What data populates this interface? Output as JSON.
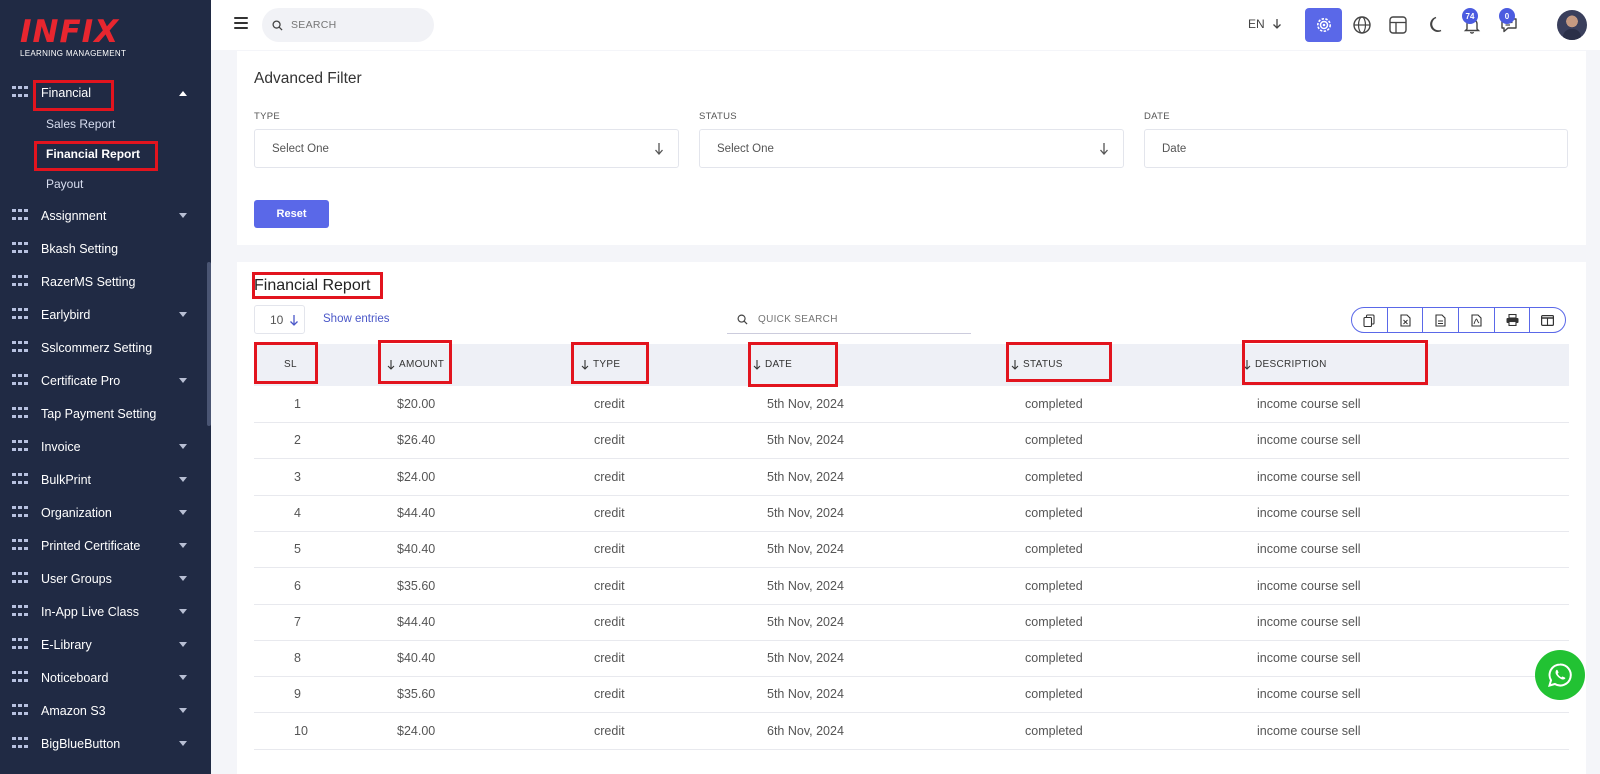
{
  "logo": {
    "main": "INFIX",
    "sub": "LEARNING MANAGEMENT"
  },
  "sidebar": {
    "financial": {
      "label": "Financial",
      "children": [
        "Sales Report",
        "Financial Report",
        "Payout"
      ]
    },
    "items": [
      "Assignment",
      "Bkash Setting",
      "RazerMS Setting",
      "Earlybird",
      "Sslcommerz Setting",
      "Certificate Pro",
      "Tap Payment Setting",
      "Invoice",
      "BulkPrint",
      "Organization",
      "Printed Certificate",
      "User Groups",
      "In-App Live Class",
      "E-Library",
      "Noticeboard",
      "Amazon S3",
      "BigBlueButton"
    ]
  },
  "topbar": {
    "search_placeholder": "SEARCH",
    "language": "EN",
    "notifications_count": "74",
    "messages_count": "0"
  },
  "filter": {
    "title": "Advanced Filter",
    "type_label": "TYPE",
    "type_value": "Select One",
    "status_label": "STATUS",
    "status_value": "Select One",
    "date_label": "DATE",
    "date_placeholder": "Date",
    "reset_label": "Reset"
  },
  "report": {
    "title": "Financial Report",
    "entries_value": "10",
    "show_entries": "Show entries",
    "quick_search_placeholder": "QUICK SEARCH",
    "columns": [
      "SL",
      "AMOUNT",
      "TYPE",
      "DATE",
      "STATUS",
      "DESCRIPTION"
    ],
    "rows": [
      [
        "1",
        "$20.00",
        "credit",
        "5th Nov, 2024",
        "completed",
        "income course sell"
      ],
      [
        "2",
        "$26.40",
        "credit",
        "5th Nov, 2024",
        "completed",
        "income course sell"
      ],
      [
        "3",
        "$24.00",
        "credit",
        "5th Nov, 2024",
        "completed",
        "income course sell"
      ],
      [
        "4",
        "$44.40",
        "credit",
        "5th Nov, 2024",
        "completed",
        "income course sell"
      ],
      [
        "5",
        "$40.40",
        "credit",
        "5th Nov, 2024",
        "completed",
        "income course sell"
      ],
      [
        "6",
        "$35.60",
        "credit",
        "5th Nov, 2024",
        "completed",
        "income course sell"
      ],
      [
        "7",
        "$44.40",
        "credit",
        "5th Nov, 2024",
        "completed",
        "income course sell"
      ],
      [
        "8",
        "$40.40",
        "credit",
        "5th Nov, 2024",
        "completed",
        "income course sell"
      ],
      [
        "9",
        "$35.60",
        "credit",
        "5th Nov, 2024",
        "completed",
        "income course sell"
      ],
      [
        "10",
        "$24.00",
        "credit",
        "6th Nov, 2024",
        "completed",
        "income course sell"
      ]
    ]
  },
  "colors": {
    "sidebar_bg": "#202a44",
    "accent": "#5a68e8",
    "highlight_box": "#e2141e",
    "whatsapp": "#22c233"
  }
}
